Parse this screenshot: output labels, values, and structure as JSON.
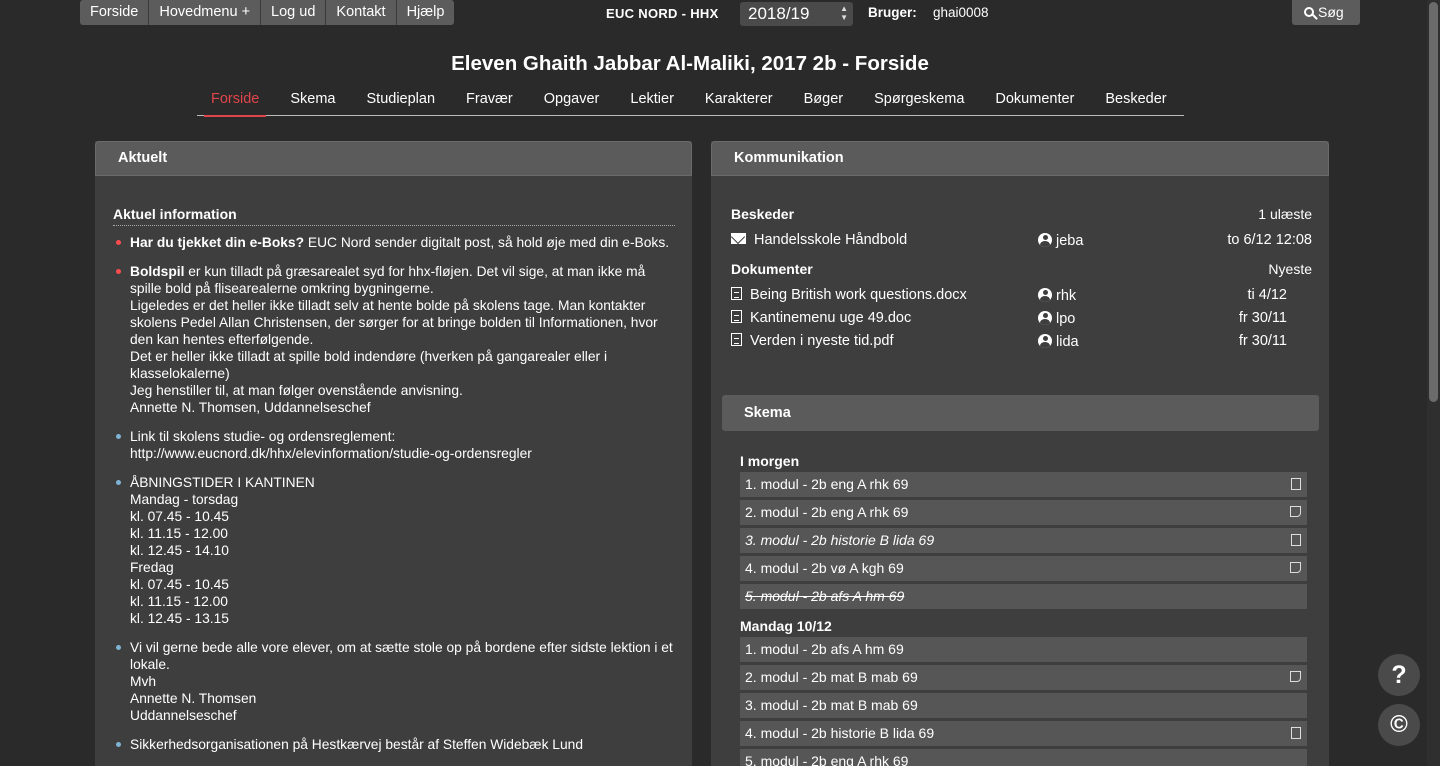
{
  "topnav": [
    "Forside",
    "Hovedmenu +",
    "Log ud",
    "Kontakt",
    "Hjælp"
  ],
  "school": "EUC NORD - HHX",
  "year": "2018/19",
  "user": {
    "label": "Bruger:",
    "value": "ghai0008"
  },
  "search_label": "Søg",
  "title": "Eleven Ghaith Jabbar Al-Maliki, 2017 2b - Forside",
  "tabs": [
    "Forside",
    "Skema",
    "Studieplan",
    "Fravær",
    "Opgaver",
    "Lektier",
    "Karakterer",
    "Bøger",
    "Spørgeskema",
    "Dokumenter",
    "Beskeder"
  ],
  "aktuelt": {
    "header": "Aktuelt",
    "section": "Aktuel information",
    "items": [
      {
        "bold": "Har du tjekket din e-Boks?",
        "text": " EUC Nord sender digitalt post, så hold øje med din e-Boks."
      },
      {
        "bold": "Boldspil",
        "text": " er kun tilladt på græsarealet syd for hhx-fløjen. Det vil sige, at man ikke må spille bold på flisearealerne omkring bygningerne.\nLigeledes er det heller ikke tilladt selv at hente bolde på skolens tage. Man kontakter skolens Pedel Allan Christensen, der sørger for at bringe bolden til Informationen, hvor den kan hentes efterfølgende.\nDet er heller ikke tilladt at spille bold indendøre (hverken på gangarealer eller i klasselokalerne)\nJeg henstiller til, at man følger ovenstående anvisning.\nAnnette N. Thomsen, Uddannelseschef"
      },
      {
        "bold": "",
        "text": "Link til skolens studie- og ordensreglement:\nhttp://www.eucnord.dk/hhx/elevinformation/studie-og-ordensregler"
      },
      {
        "bold": "",
        "text": "ÅBNINGSTIDER I KANTINEN\nMandag - torsdag\nkl.  07.45 - 10.45\nkl. 11.15 - 12.00\nkl. 12.45 - 14.10\nFredag\nkl. 07.45 - 10.45\nkl. 11.15 - 12.00\nkl. 12.45 - 13.15"
      },
      {
        "bold": "",
        "text": "Vi vil gerne bede alle vore elever, om at sætte stole op på bordene efter sidste lektion i et lokale.\nMvh\nAnnette N. Thomsen\nUddannelseschef"
      },
      {
        "bold": "",
        "text": "Sikkerhedsorganisationen på Hestkærvej består af Steffen Widebæk Lund"
      }
    ]
  },
  "kommunikation": {
    "header": "Kommunikation",
    "beskeder": {
      "label": "Beskeder",
      "count": "1 ulæste",
      "rows": [
        {
          "title": "Handelsskole Håndbold",
          "user": "jeba",
          "date": "to 6/12 12:08"
        }
      ]
    },
    "dokumenter": {
      "label": "Dokumenter",
      "sort": "Nyeste",
      "rows": [
        {
          "title": "Being British work questions.docx",
          "user": "rhk",
          "date": "ti 4/12"
        },
        {
          "title": "Kantinemenu uge 49.doc",
          "user": "lpo",
          "date": "fr 30/11"
        },
        {
          "title": "Verden i nyeste tid.pdf",
          "user": "lida",
          "date": "fr 30/11"
        }
      ]
    }
  },
  "skema": {
    "header": "Skema",
    "days": [
      {
        "label": "I morgen",
        "lessons": [
          {
            "text": "1. modul - 2b eng A  rhk  69",
            "style": "",
            "icon": "doc"
          },
          {
            "text": "2. modul - 2b eng A  rhk  69",
            "style": "",
            "icon": "note"
          },
          {
            "text": "3. modul - 2b historie B  lida  69",
            "style": "italic",
            "icon": "doc"
          },
          {
            "text": "4. modul - 2b vø A  kgh  69",
            "style": "",
            "icon": "note"
          },
          {
            "text": "5. modul - 2b afs A  hm  69",
            "style": "cancelled",
            "icon": ""
          }
        ]
      },
      {
        "label": "Mandag 10/12",
        "lessons": [
          {
            "text": "1. modul - 2b afs A  hm  69",
            "style": "",
            "icon": ""
          },
          {
            "text": "2. modul - 2b mat B  mab  69",
            "style": "",
            "icon": "note"
          },
          {
            "text": "3. modul - 2b mat B  mab  69",
            "style": "",
            "icon": ""
          },
          {
            "text": "4. modul - 2b historie B  lida  69",
            "style": "",
            "icon": "doc"
          },
          {
            "text": "5. modul - 2b eng A  rhk  69",
            "style": "",
            "icon": ""
          }
        ]
      }
    ]
  },
  "help_label": "?",
  "copyright_label": "©"
}
